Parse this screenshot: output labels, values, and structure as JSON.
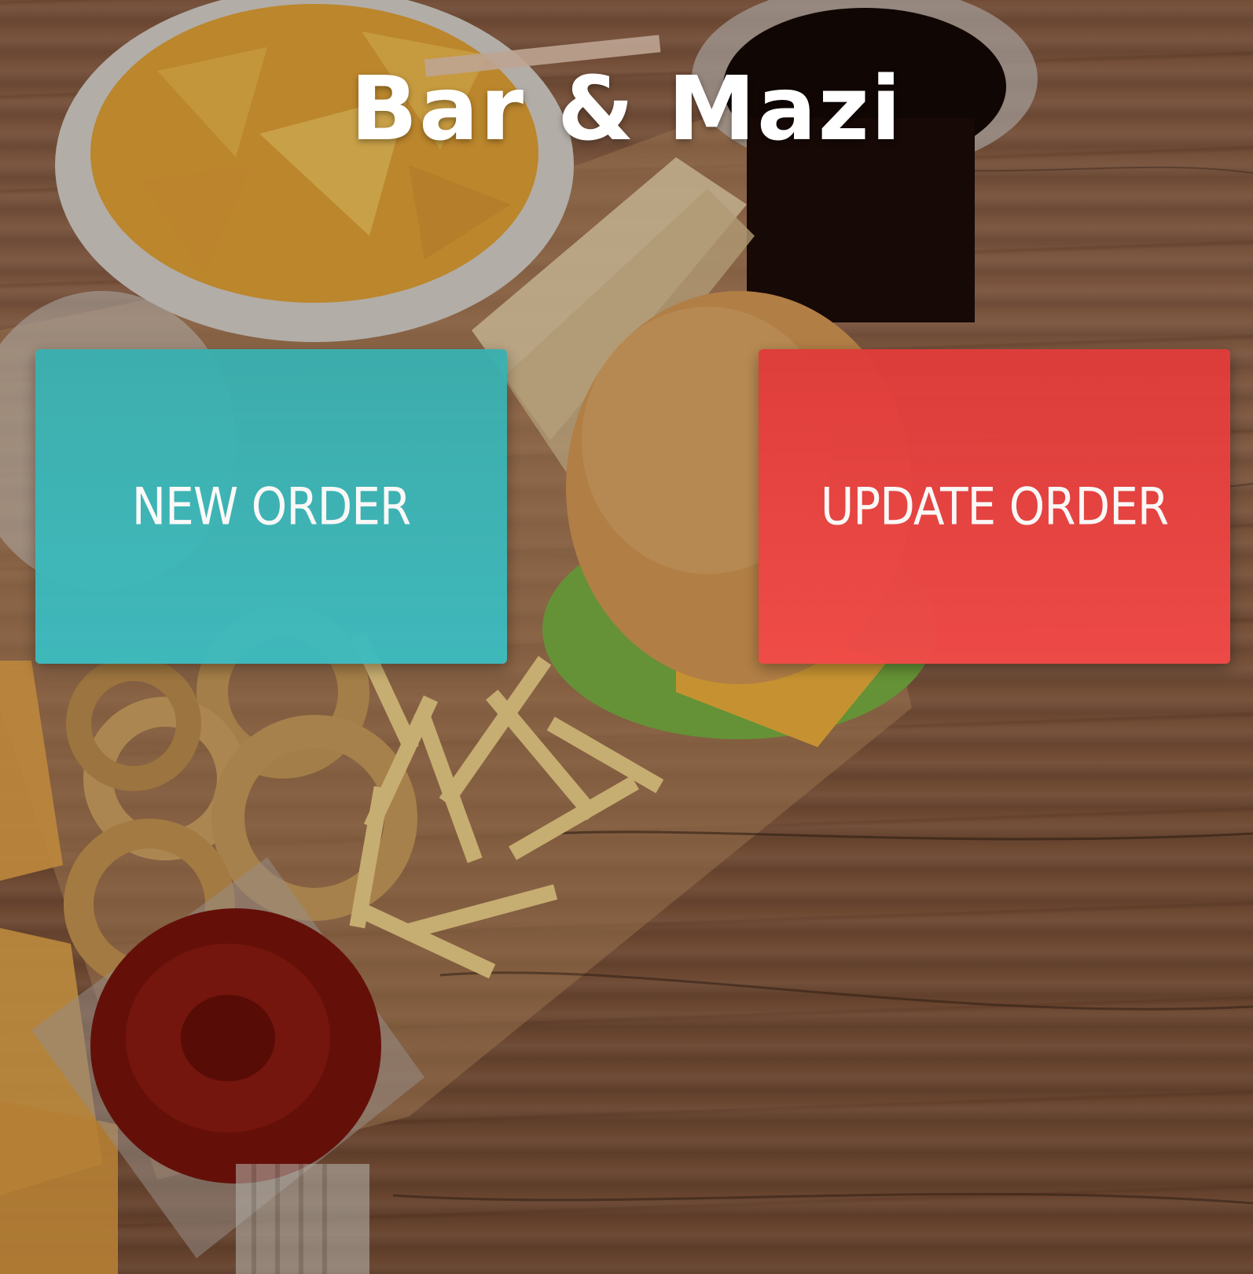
{
  "header": {
    "title": "Bar & Mazi"
  },
  "actions": {
    "new_order_label": "NEW ORDER",
    "update_order_label": "UPDATE ORDER"
  },
  "colors": {
    "new_order": "#3dbcc0",
    "update_order": "#f24a48",
    "title_text": "#ffffff",
    "background_wood": "#8d5f44"
  }
}
